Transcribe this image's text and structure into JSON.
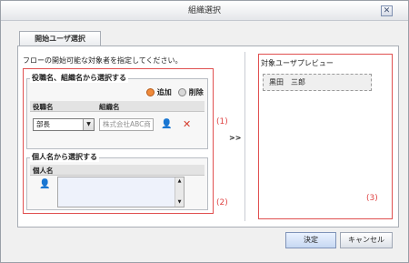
{
  "window": {
    "title": "組織選択",
    "close_glyph": "✕"
  },
  "tab": {
    "label": "開始ユーザ選択"
  },
  "instruction": "フローの開始可能な対象者を指定してください。",
  "section1": {
    "title": "役職名、組織名から選択する",
    "add_label": "追加",
    "delete_label": "削除",
    "col_position": "役職名",
    "col_org": "組織名",
    "position_value": "部長",
    "org_value": "株式会社ABC商"
  },
  "section2": {
    "title": "個人名から選択する",
    "col_person": "個人名"
  },
  "arrow_label": ">>",
  "preview": {
    "title": "対象ユーザプレビュー",
    "items": [
      "黒田　三郎"
    ]
  },
  "markers": {
    "m1": "(1)",
    "m2": "(2)",
    "m3": "(3)"
  },
  "buttons": {
    "ok": "決定",
    "cancel": "キャンセル"
  },
  "colors": {
    "marker_red": "#e04545",
    "accent_blue": "#c7d8f2"
  }
}
